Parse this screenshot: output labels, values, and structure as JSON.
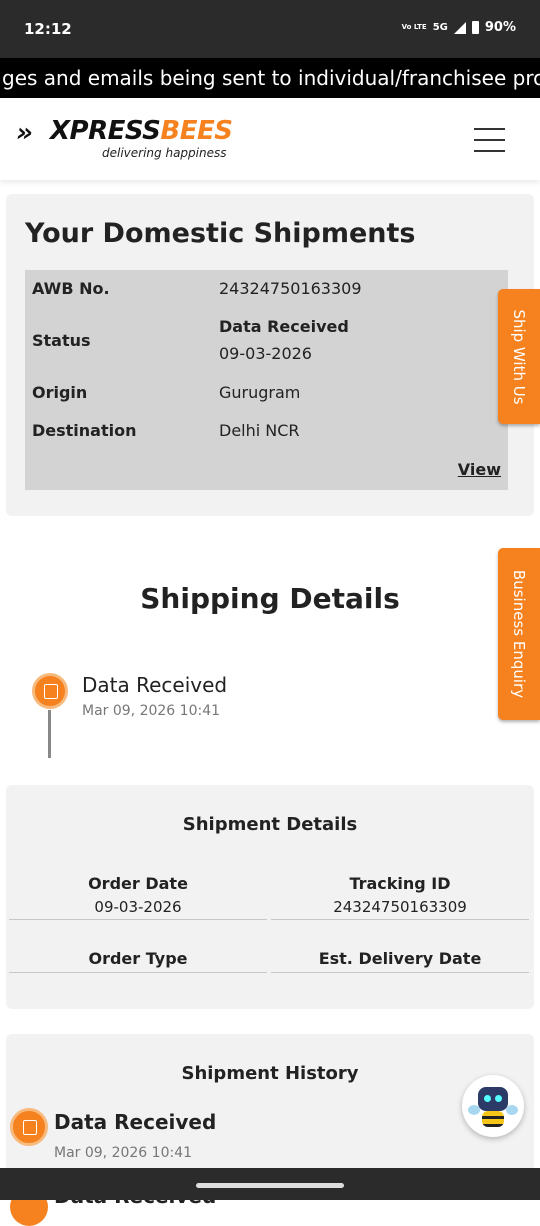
{
  "status_bar": {
    "time": "12:12",
    "volte": "Vo LTE",
    "network": "5G",
    "battery": "90%"
  },
  "marquee": {
    "text": "ges and emails being sent to individual/franchisee pro"
  },
  "header": {
    "logo_chevrons": "»",
    "logo_x": "XPRESS",
    "logo_bees": "BEES",
    "logo_tagline": "delivering happiness"
  },
  "domestic": {
    "title": "Your Domestic Shipments",
    "awb_label": "AWB No.",
    "awb_value": "24324750163309",
    "status_label": "Status",
    "status_value": "Data Received",
    "status_date": "09-03-2026",
    "origin_label": "Origin",
    "origin_value": "Gurugram",
    "destination_label": "Destination",
    "destination_value": "Delhi NCR",
    "view_link": "View"
  },
  "side_tabs": {
    "ship_with_us": "Ship With Us",
    "business_enquiry": "Business Enquiry"
  },
  "shipping_details": {
    "title": "Shipping Details",
    "timeline": [
      {
        "status": "Data Received",
        "time": "Mar 09, 2026 10:41"
      }
    ]
  },
  "shipment_details": {
    "title": "Shipment Details",
    "order_date_label": "Order Date",
    "order_date_value": "09-03-2026",
    "tracking_id_label": "Tracking ID",
    "tracking_id_value": "24324750163309",
    "order_type_label": "Order Type",
    "est_delivery_label": "Est. Delivery Date"
  },
  "shipment_history": {
    "title": "Shipment History",
    "items": [
      {
        "status": "Data Received",
        "time": "Mar 09, 2026 10:41"
      },
      {
        "status": "Data Received"
      }
    ]
  },
  "colors": {
    "brand_orange": "#f5821f",
    "dark_bar": "#2b2b2b"
  }
}
